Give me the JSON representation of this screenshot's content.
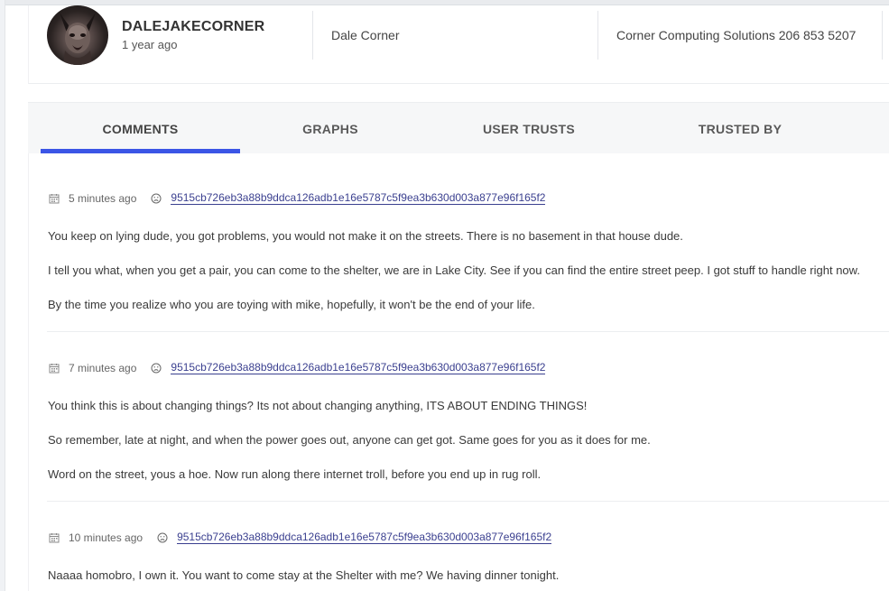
{
  "profile": {
    "username": "DALEJAKECORNER",
    "joined": "1 year ago",
    "name": "Dale Corner",
    "company": "Corner Computing Solutions 206 853 5207"
  },
  "tabs": [
    {
      "label": "COMMENTS",
      "active": true
    },
    {
      "label": "GRAPHS",
      "active": false
    },
    {
      "label": "USER TRUSTS",
      "active": false
    },
    {
      "label": "TRUSTED BY",
      "active": false
    }
  ],
  "comments": [
    {
      "time": "5 minutes ago",
      "hash": "9515cb726eb3a88b9ddca126adb1e16e5787c5f9ea3b630d003a877e96f165f2",
      "lines": [
        "You keep on lying dude, you got problems, you would not make it on the streets. There is no basement in that house dude.",
        "I tell you what, when you get a pair, you can come to the shelter, we are in Lake City. See if you can find the entire street peep. I got stuff to handle right now.",
        "By the time you realize who you are toying with mike, hopefully, it won't be the end of your life."
      ]
    },
    {
      "time": "7 minutes ago",
      "hash": "9515cb726eb3a88b9ddca126adb1e16e5787c5f9ea3b630d003a877e96f165f2",
      "lines": [
        "You think this is about changing things? Its not about changing anything, ITS ABOUT ENDING THINGS!",
        "So remember, late at night, and when the power goes out, anyone can get got. Same goes for you as it does for me.",
        "Word on the street, yous a hoe. Now run along there internet troll, before you end up in rug roll."
      ]
    },
    {
      "time": "10 minutes ago",
      "hash": "9515cb726eb3a88b9ddca126adb1e16e5787c5f9ea3b630d003a877e96f165f2",
      "lines": [
        "Naaaa homobro, I own it. You want to come stay at the Shelter with me? We having dinner tonight."
      ]
    }
  ]
}
